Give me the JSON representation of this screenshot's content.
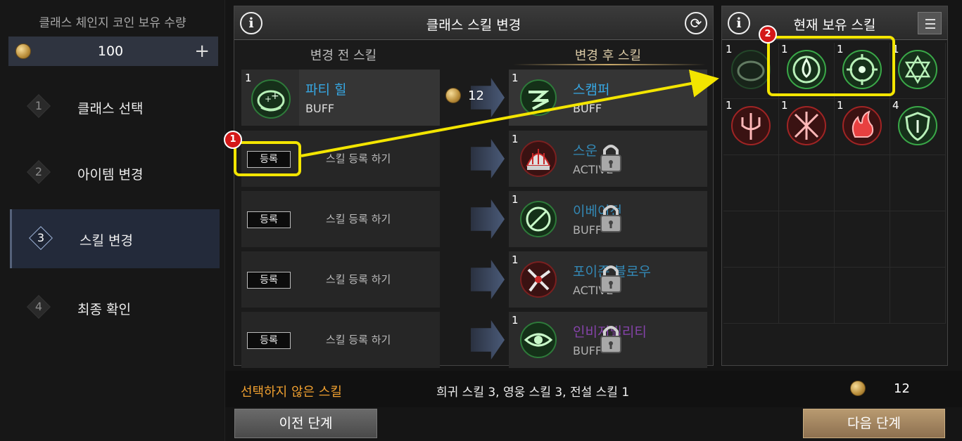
{
  "left": {
    "coin_title": "클래스 체인지 코인 보유 수량",
    "coin_amount": "100",
    "plus_label": "+",
    "steps": [
      {
        "num": "1",
        "label": "클래스 선택"
      },
      {
        "num": "2",
        "label": "아이템 변경"
      },
      {
        "num": "3",
        "label": "스킬 변경"
      },
      {
        "num": "4",
        "label": "최종 확인"
      }
    ],
    "active_step": 3
  },
  "center": {
    "info_label": "i",
    "title": "클래스 스킬 변경",
    "refresh_label": "⟳",
    "before_header": "변경 전 스킬",
    "after_header": "변경 후 스킬",
    "rows": [
      {
        "before_tier": "1",
        "before_name": "파티 힐",
        "before_type": "BUFF",
        "cost": "12",
        "after_tier": "1",
        "after_name": "스캠퍼",
        "after_type": "BUFF"
      },
      {
        "register": "등록",
        "hint": "스킬 등록 하기",
        "after_tier": "1",
        "after_name": "스운",
        "after_type": "ACTIVE"
      },
      {
        "register": "등록",
        "hint": "스킬 등록 하기",
        "after_tier": "1",
        "after_name": "이베이전",
        "after_type": "BUFF"
      },
      {
        "register": "등록",
        "hint": "스킬 등록 하기",
        "after_tier": "1",
        "after_name": "포이즌 블로우",
        "after_type": "ACTIVE"
      },
      {
        "register": "등록",
        "hint": "스킬 등록 하기",
        "after_tier": "1",
        "after_name": "인비저빌리티",
        "after_type": "BUFF"
      }
    ]
  },
  "right": {
    "info_label": "i",
    "title": "현재 보유 스킬",
    "skills": [
      {
        "tier": "1",
        "icon": "party-heal-icon",
        "color": "#3aa848"
      },
      {
        "tier": "1",
        "icon": "water-drop-icon",
        "color": "#3aa848"
      },
      {
        "tier": "1",
        "icon": "target-icon",
        "color": "#3aa848"
      },
      {
        "tier": "1",
        "icon": "hexagram-icon",
        "color": "#3aa848"
      },
      {
        "tier": "1",
        "icon": "trident-icon",
        "color": "#c83030"
      },
      {
        "tier": "1",
        "icon": "crossed-blades-icon",
        "color": "#c83030"
      },
      {
        "tier": "1",
        "icon": "flame-icon",
        "color": "#c83030"
      },
      {
        "tier": "4",
        "icon": "shield-icon",
        "color": "#3aa848"
      }
    ]
  },
  "bottom": {
    "unselected_label": "선택하지 않은 스킬",
    "unselected_value": "희귀 스킬 3, 영웅 스킬 3, 전설 스킬 1",
    "total_cost": "12",
    "prev_button": "이전 단계",
    "next_button": "다음 단계"
  },
  "annotations": {
    "badge1": "1",
    "badge2": "2",
    "highlight_color": "#f3e500",
    "badge_color": "#d41818"
  },
  "colors": {
    "skill_name_blue": "#36a8e4",
    "skill_name_purple": "#a34bd4",
    "unselected_orange": "#f0a030",
    "next_button_gold": "#b89a70"
  }
}
